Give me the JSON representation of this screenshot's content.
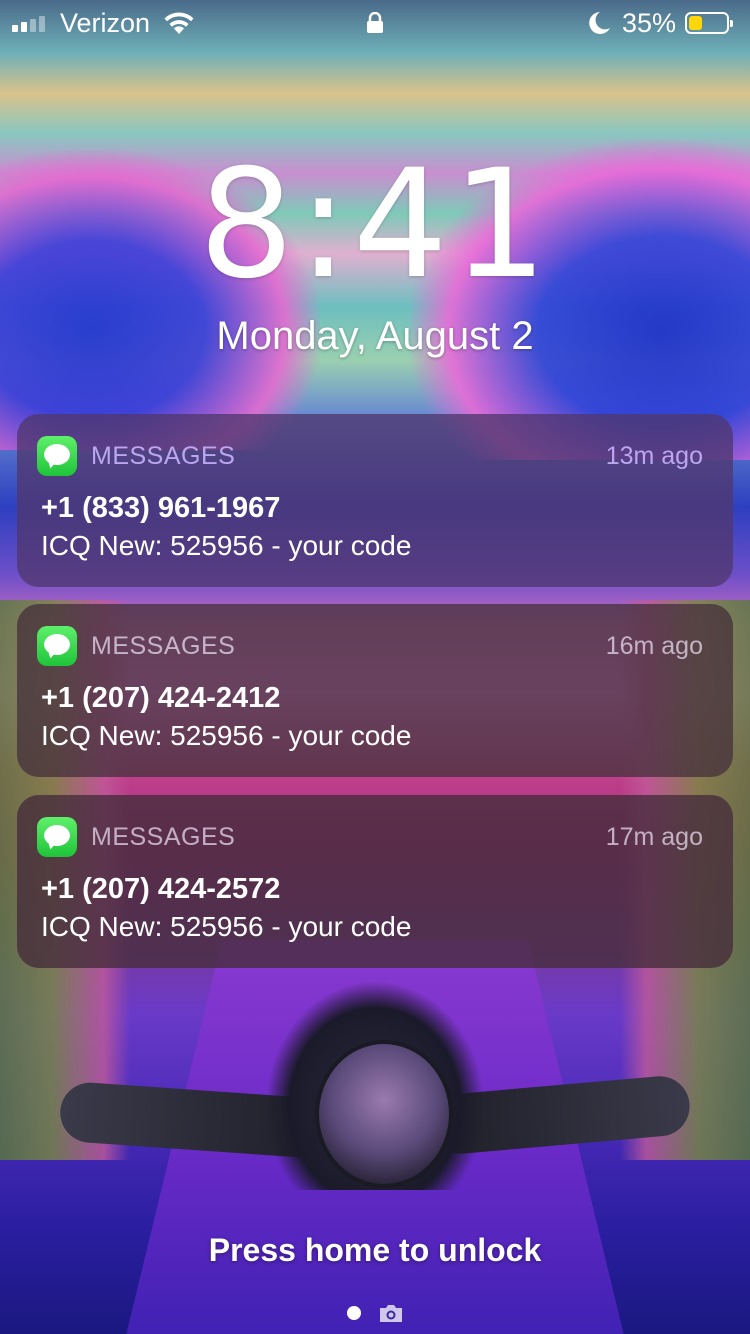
{
  "status_bar": {
    "carrier": "Verizon",
    "signal_bars": 2,
    "signal_bars_total": 4,
    "battery_percent": "35%",
    "battery_level": 0.35,
    "battery_color": "#ffd60a",
    "icons": [
      "signal-icon",
      "wifi-icon",
      "lock-icon",
      "moon-icon",
      "battery-icon"
    ]
  },
  "lock_screen": {
    "time": "8:41",
    "date": "Monday, August 2",
    "unlock_hint": "Press home to unlock"
  },
  "notifications": [
    {
      "app": "MESSAGES",
      "time_ago": "13m ago",
      "sender": "+1 (833) 961-1967",
      "body": "ICQ New: 525956 - your code"
    },
    {
      "app": "MESSAGES",
      "time_ago": "16m ago",
      "sender": "+1 (207) 424-2412",
      "body": "ICQ New: 525956 - your code"
    },
    {
      "app": "MESSAGES",
      "time_ago": "17m ago",
      "sender": "+1 (207) 424-2572",
      "body": "ICQ New: 525956 - your code"
    }
  ],
  "page_indicator": {
    "icons": [
      "page-dot",
      "camera-icon"
    ]
  },
  "colors": {
    "messages_green": "#34c759"
  }
}
